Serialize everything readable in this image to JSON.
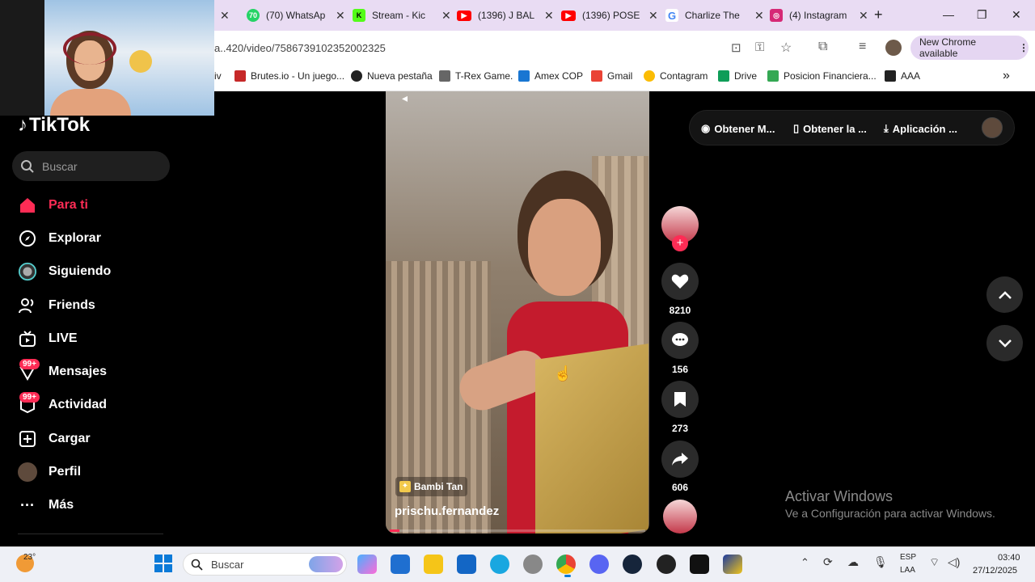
{
  "browser": {
    "tabs": [
      {
        "title": "(70) WhatsAp",
        "icon": "whatsapp-icon",
        "color": "#25d366",
        "badge": "70"
      },
      {
        "title": "Stream - Kic",
        "icon": "kick-icon",
        "color": "#53fc18",
        "badge": "K"
      },
      {
        "title": "(1396) J BAL",
        "icon": "youtube-icon",
        "color": "#ff0000",
        "badge": "▶"
      },
      {
        "title": "(1396) POSE",
        "icon": "youtube-icon",
        "color": "#ff0000",
        "badge": "▶"
      },
      {
        "title": "Charlize The",
        "icon": "google-icon",
        "color": "#4285f4",
        "badge": "G"
      },
      {
        "title": "(4) Instagram",
        "icon": "instagram-icon",
        "color": "#d62976",
        "badge": "◎"
      }
    ],
    "new_tab": "+",
    "url": "a..420/video/7586739102352002325",
    "new_chrome": "New Chrome available",
    "bookmarks": [
      {
        "label": "iv",
        "color": "#777"
      },
      {
        "label": "Brutes.io - Un juego...",
        "color": "#c62828"
      },
      {
        "label": "Nueva pestaña",
        "color": "#222"
      },
      {
        "label": "T-Rex Game.",
        "color": "#555"
      },
      {
        "label": "Amex COP",
        "color": "#1976d2"
      },
      {
        "label": "Gmail",
        "color": "#ea4335"
      },
      {
        "label": "Contagram",
        "color": "#fbbc04"
      },
      {
        "label": "Drive",
        "color": "#0f9d58"
      },
      {
        "label": "Posicion Financiera...",
        "color": "#34a853"
      },
      {
        "label": "AAA",
        "color": "#222"
      }
    ]
  },
  "tiktok": {
    "logo": "TikTok",
    "search_placeholder": "Buscar",
    "nav": [
      {
        "label": "Para ti",
        "icon": "home-icon",
        "active": true
      },
      {
        "label": "Explorar",
        "icon": "compass-icon"
      },
      {
        "label": "Siguiendo",
        "icon": "following-icon"
      },
      {
        "label": "Friends",
        "icon": "friends-icon"
      },
      {
        "label": "LIVE",
        "icon": "live-icon"
      },
      {
        "label": "Mensajes",
        "icon": "messages-icon",
        "badge": "99+"
      },
      {
        "label": "Actividad",
        "icon": "activity-icon",
        "badge": "99+"
      },
      {
        "label": "Cargar",
        "icon": "upload-icon"
      },
      {
        "label": "Perfil",
        "icon": "profile-avatar-icon"
      },
      {
        "label": "Más",
        "icon": "more-icon"
      }
    ],
    "top_pills": [
      "Obtener M...",
      "Obtener la ...",
      "Aplicación ..."
    ],
    "video": {
      "sound_tag": "Bambi Tan",
      "username": "prischu.fernandez"
    },
    "actions": {
      "likes": "8210",
      "comments": "156",
      "saves": "273",
      "shares": "606"
    },
    "watermark": {
      "title": "Activar Windows",
      "subtitle": "Ve a Configuración para activar Windows."
    }
  },
  "taskbar": {
    "weather": "23°",
    "search": "Buscar",
    "lang1": "ESP",
    "lang2": "LAA",
    "time": "03:40",
    "date": "27/12/2025"
  }
}
